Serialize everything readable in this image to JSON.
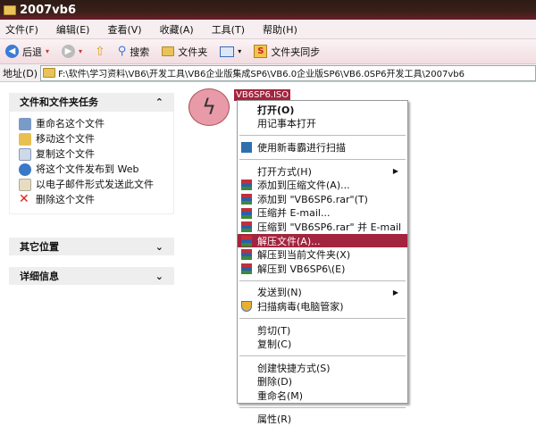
{
  "window": {
    "title": "2007vb6"
  },
  "menubar": [
    "文件(F)",
    "编辑(E)",
    "查看(V)",
    "收藏(A)",
    "工具(T)",
    "帮助(H)"
  ],
  "toolbar": {
    "back": "后退",
    "search": "搜索",
    "folders": "文件夹",
    "sync": "文件夹同步"
  },
  "address": {
    "label": "地址(D)",
    "path": "F:\\软件\\学习资料\\VB6\\开发工具\\VB6企业版集成SP6\\VB6.0企业版SP6\\VB6.0SP6开发工具\\2007vb6"
  },
  "sidebar": {
    "tasks": {
      "title": "文件和文件夹任务",
      "items": [
        "重命名这个文件",
        "移动这个文件",
        "复制这个文件",
        "将这个文件发布到 Web",
        "以电子邮件形式发送此文件",
        "删除这个文件"
      ]
    },
    "other": {
      "title": "其它位置"
    },
    "details": {
      "title": "详细信息"
    }
  },
  "file": {
    "name": "VB6SP6.ISO"
  },
  "context_menu": [
    "打开(O)",
    "用记事本打开",
    "使用新毒霸进行扫描",
    "打开方式(H)",
    "添加到压缩文件(A)...",
    "添加到 \"VB6SP6.rar\"(T)",
    "压缩并 E-mail...",
    "压缩到 \"VB6SP6.rar\" 并 E-mail",
    "解压文件(A)...",
    "解压到当前文件夹(X)",
    "解压到 VB6SP6\\(E)",
    "发送到(N)",
    "扫描病毒(电脑管家)",
    "剪切(T)",
    "复制(C)",
    "创建快捷方式(S)",
    "删除(D)",
    "重命名(M)",
    "属性(R)"
  ]
}
